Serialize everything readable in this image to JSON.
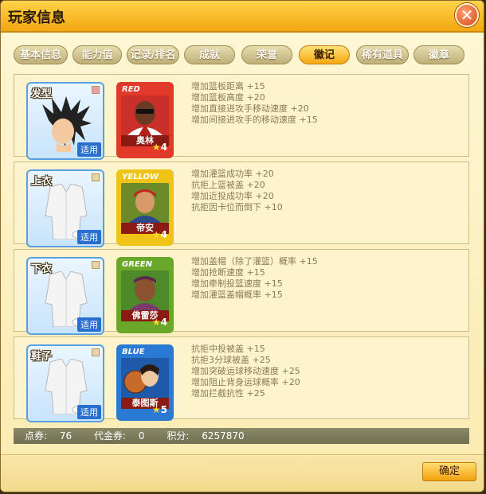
{
  "window": {
    "title": "玩家信息"
  },
  "tabs": [
    {
      "label": "基本信息"
    },
    {
      "label": "能力值"
    },
    {
      "label": "记录/排名"
    },
    {
      "label": "成就"
    },
    {
      "label": "荣誉"
    },
    {
      "label": "徽记",
      "active": true
    },
    {
      "label": "稀有道具"
    },
    {
      "label": "徽章"
    }
  ],
  "rows": [
    {
      "slot_label": "发型",
      "apply_label": "适用",
      "card": {
        "color_tag": "RED",
        "name": "奥林",
        "stars": "4",
        "color": "#e23a2a"
      },
      "stats": [
        "增加篮板距离 +15",
        "增加篮板高度 +20",
        "增加直接进攻手移动速度 +20",
        "增加间接进攻手的移动速度 +15"
      ]
    },
    {
      "slot_label": "上衣",
      "apply_label": "适用",
      "card": {
        "color_tag": "YELLOW",
        "name": "帝安",
        "stars": "4",
        "color": "#f0c416"
      },
      "stats": [
        "增加灌篮成功率 +20",
        "抗拒上篮被盖 +20",
        "增加近投成功率 +20",
        "抗拒因卡位而倒下 +10"
      ]
    },
    {
      "slot_label": "下衣",
      "apply_label": "适用",
      "card": {
        "color_tag": "GREEN",
        "name": "佛雷莎",
        "stars": "4",
        "color": "#6aa82a"
      },
      "stats": [
        "增加盖帽（除了灌篮）概率 +15",
        "增加抢断速度 +15",
        "增加牵制投篮速度 +15",
        "增加灌篮盖帽概率 +15"
      ]
    },
    {
      "slot_label": "鞋子",
      "apply_label": "适用",
      "card": {
        "color_tag": "BLUE",
        "name": "泰图斯",
        "stars": "5",
        "color": "#2a7ad4"
      },
      "stats": [
        "抗拒中投被盖 +15",
        "抗拒3分球被盖 +25",
        "增加突破运球移动速度 +25",
        "增加阻止背身运球概率 +20",
        "增加拦截抗性 +25"
      ]
    }
  ],
  "status": {
    "points_label": "点券:",
    "points_value": "76",
    "voucher_label": "代金券:",
    "voucher_value": "0",
    "score_label": "积分:",
    "score_value": "6257870"
  },
  "footer": {
    "ok_label": "确定"
  }
}
